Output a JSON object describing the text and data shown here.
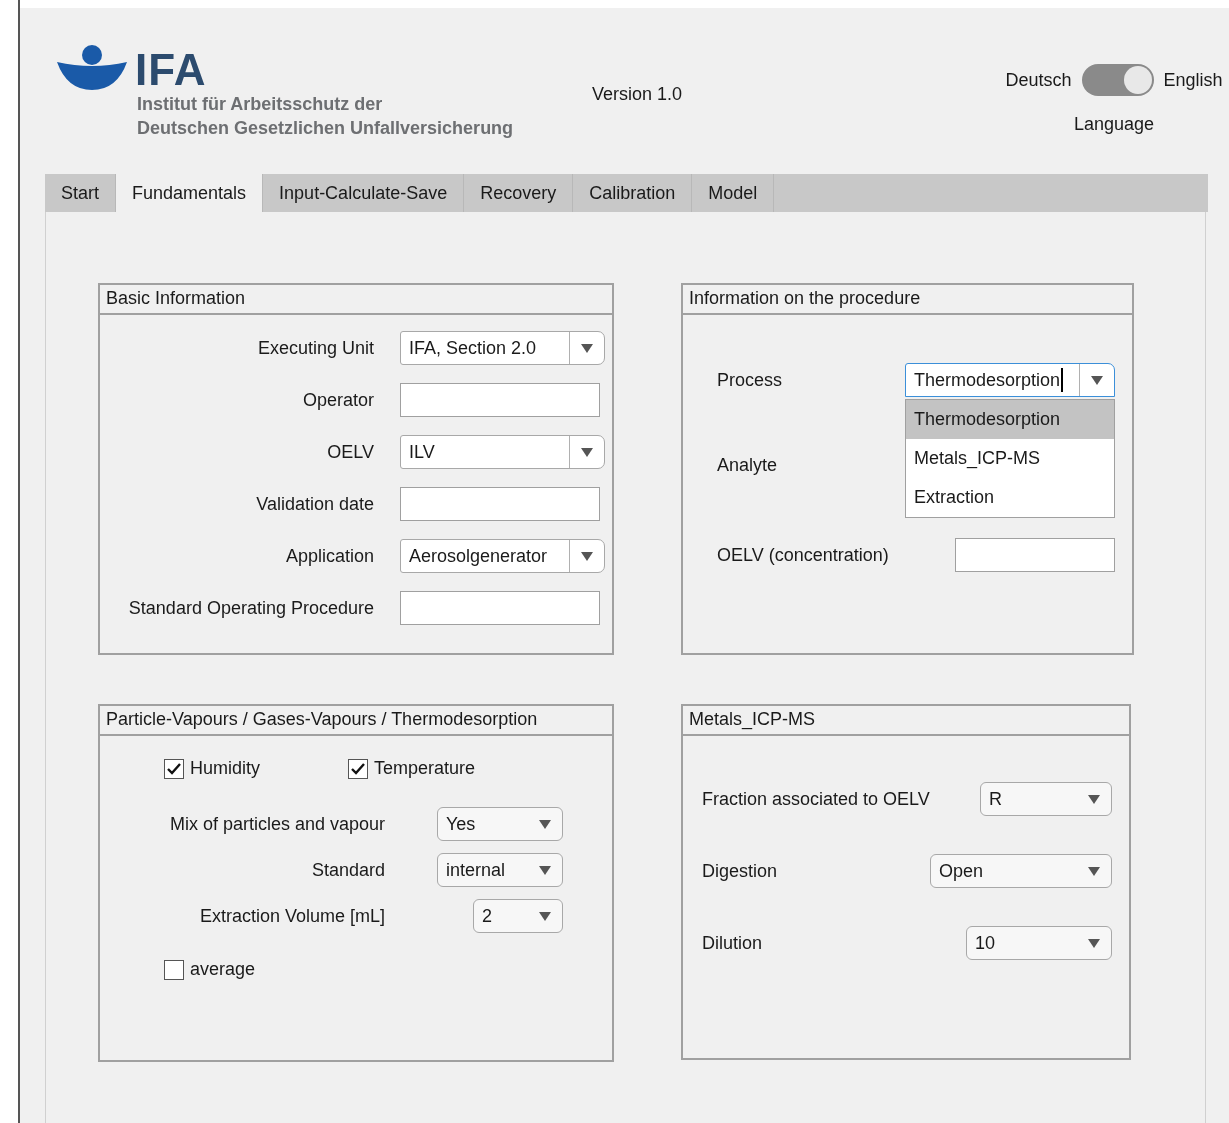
{
  "header": {
    "logo_text": "IFA",
    "logo_subtitle": [
      "Institut für Arbeitsschutz der",
      "Deutschen Gesetzlichen Unfallversicherung"
    ],
    "version": "Version 1.0"
  },
  "language": {
    "left_label": "Deutsch",
    "right_label": "English",
    "on": true,
    "caption": "Language"
  },
  "tabs": [
    {
      "label": "Start",
      "selected": false
    },
    {
      "label": "Fundamentals",
      "selected": true
    },
    {
      "label": "Input-Calculate-Save",
      "selected": false
    },
    {
      "label": "Recovery",
      "selected": false
    },
    {
      "label": "Calibration",
      "selected": false
    },
    {
      "label": "Model",
      "selected": false
    }
  ],
  "basic_information": {
    "title": "Basic Information",
    "rows": [
      {
        "label": "Executing Unit",
        "kind": "dropdown",
        "value": "IFA, Section 2.0"
      },
      {
        "label": "Operator",
        "kind": "field"
      },
      {
        "label": "OELV",
        "kind": "dropdown",
        "value": "ILV"
      },
      {
        "label": "Validation date",
        "kind": "field"
      },
      {
        "label": "Application",
        "kind": "dropdown",
        "value": "Aerosolgenerator"
      },
      {
        "label": "Standard Operating Procedure",
        "kind": "field"
      }
    ]
  },
  "procedure": {
    "title": "Information on the procedure",
    "process": {
      "label": "Process",
      "value": "Thermodesorption",
      "focused": true,
      "open": true,
      "options": [
        {
          "label": "Thermodesorption",
          "selected": true
        },
        {
          "label": "Metals_ICP-MS",
          "selected": false
        },
        {
          "label": "Extraction",
          "selected": false
        }
      ]
    },
    "analyte": {
      "label": "Analyte"
    },
    "oelv_concentration": {
      "label": "OELV (concentration)"
    }
  },
  "particle_vapours": {
    "title": "Particle-Vapours / Gases-Vapours / Thermodesorption",
    "checkboxes": [
      {
        "label": "Humidity",
        "checked": true
      },
      {
        "label": "Temperature",
        "checked": true
      }
    ],
    "rows": [
      {
        "label": "Mix of particles and vapour",
        "value": "Yes"
      },
      {
        "label": "Standard",
        "value": "internal"
      },
      {
        "label": "Extraction Volume [mL]",
        "value": "2"
      }
    ],
    "average": {
      "label": "average",
      "checked": false
    }
  },
  "metals": {
    "title": "Metals_ICP-MS",
    "rows": [
      {
        "label": "Fraction associated to OELV",
        "value": "R"
      },
      {
        "label": "Digestion",
        "value": "Open"
      },
      {
        "label": "Dilution",
        "value": "10"
      }
    ]
  }
}
